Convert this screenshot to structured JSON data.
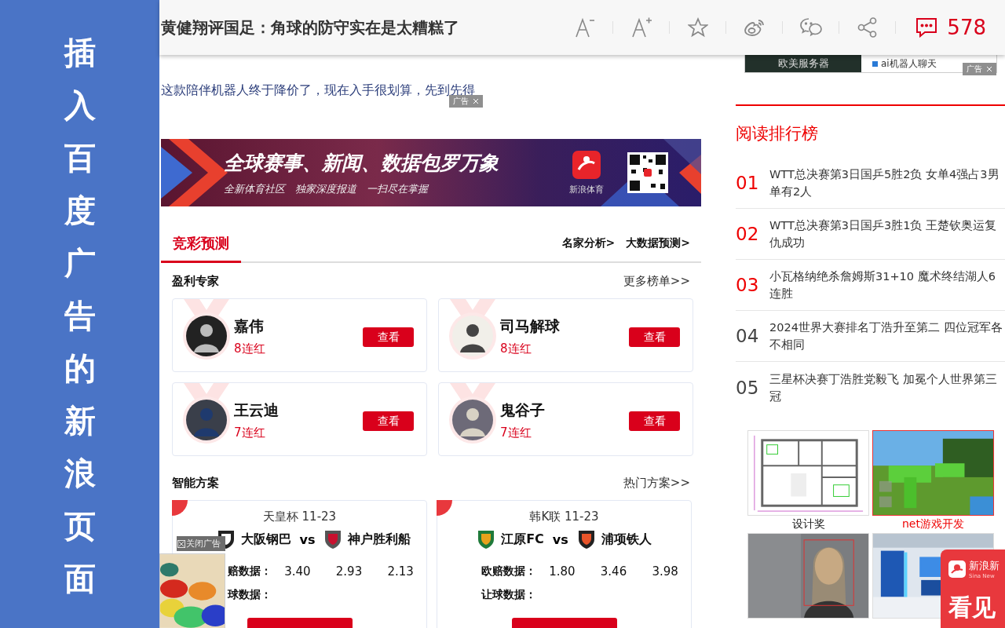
{
  "sidebar_caption": "插入百度广告的新浪页面",
  "header": {
    "title": "黄健翔评国足：角球的防守实在是太糟糕了",
    "comment_count": "578"
  },
  "top_ad": {
    "image_caption": "欧美服务器",
    "link": "ai机器人聊天",
    "tag": "广告"
  },
  "promo": {
    "text": "这款陪伴机器人终于降价了，现在入手很划算，先到先得",
    "tag": "广告"
  },
  "banner": {
    "headline": "全球赛事、新闻、数据包罗万象",
    "subline": "全新体育社区　独家深度报道　一扫尽在掌握",
    "brand": "新浪体育"
  },
  "section_tabs": [
    {
      "label": "竞彩预测",
      "selected": true
    }
  ],
  "section_links": [
    "名家分析>",
    "大数据预测>"
  ],
  "experts": {
    "title": "盈利专家",
    "more": "更多榜单>>",
    "items": [
      {
        "name": "嘉伟",
        "streak": "8连红",
        "button": "查看"
      },
      {
        "name": "司马解球",
        "streak": "8连红",
        "button": "查看"
      },
      {
        "name": "王云迪",
        "streak": "7连红",
        "button": "查看"
      },
      {
        "name": "鬼谷子",
        "streak": "7连红",
        "button": "查看"
      }
    ]
  },
  "plans": {
    "title": "智能方案",
    "more": "热门方案>>",
    "matches": [
      {
        "league": "天皇杯 11-23",
        "home": "大阪钢巴",
        "vs": "vs",
        "away": "神户胜利船",
        "odds_label": "赔数据：",
        "odds": [
          "3.40",
          "2.93",
          "2.13"
        ],
        "handicap_label": "球数据："
      },
      {
        "league": "韩K联 11-23",
        "home": "江原FC",
        "vs": "vs",
        "away": "浦项铁人",
        "odds_label": "欧赔数据：",
        "odds": [
          "1.80",
          "3.46",
          "3.98"
        ],
        "handicap_label": "让球数据："
      }
    ]
  },
  "float_ad": {
    "close": "关闭广告"
  },
  "ranking": {
    "title": "阅读排行榜",
    "items": [
      {
        "rank": "01",
        "hot": true,
        "text": "WTT总决赛第3日国乒5胜2负 女单4强占3男单有2人"
      },
      {
        "rank": "02",
        "hot": true,
        "text": "WTT总决赛第3日国乒3胜1负 王楚钦奥运复仇成功"
      },
      {
        "rank": "03",
        "hot": true,
        "text": "小瓦格纳绝杀詹姆斯31+10 魔术终结湖人6连胜"
      },
      {
        "rank": "04",
        "hot": false,
        "text": "2024世界大赛排名丁浩升至第二 四位冠军各不相同"
      },
      {
        "rank": "05",
        "hot": false,
        "text": "三星杯决赛丁浩胜党毅飞 加冕个人世界第三冠"
      }
    ]
  },
  "thumbnails": [
    {
      "caption": "设计奖",
      "selected": false
    },
    {
      "caption": "net游戏开发",
      "selected": true
    },
    {
      "selected": false
    },
    {
      "selected": false
    }
  ],
  "sina_popup": {
    "brand": "新浪新",
    "brand_en": "Sina New",
    "slogan": "看见"
  }
}
